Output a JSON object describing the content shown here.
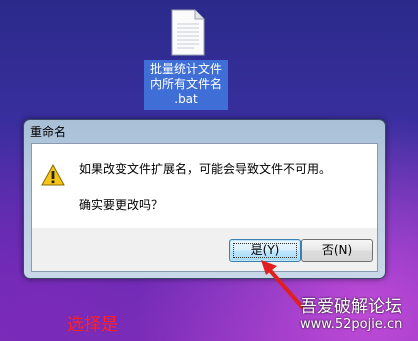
{
  "desktop": {
    "file_label": "批量统计文件\n内所有文件名\n.bat",
    "file_icon": "document-icon"
  },
  "dialog": {
    "title": "重命名",
    "message": "如果改变文件扩展名，可能会导致文件不可用。",
    "confirm": "确实要更改吗？",
    "icon": "warning-icon",
    "buttons": {
      "yes": "是(Y)",
      "no": "否(N)"
    }
  },
  "annotation": {
    "caption": "选择是",
    "arrow_color": "#e02020"
  },
  "watermark": {
    "text": "吾爱破解论坛",
    "url": "www.52pojie.cn"
  },
  "colors": {
    "accent": "#3c7fb1",
    "caption": "#ff2222"
  }
}
